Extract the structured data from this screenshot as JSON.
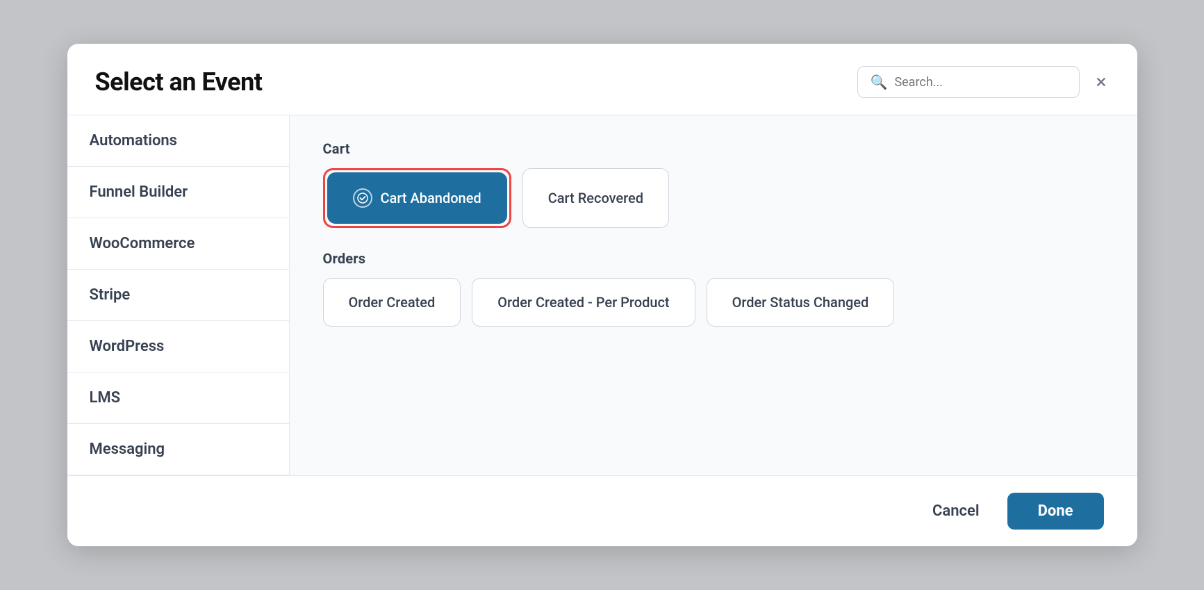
{
  "modal": {
    "title": "Select an Event",
    "search_placeholder": "Search...",
    "close_label": "×"
  },
  "sidebar": {
    "items": [
      {
        "label": "Automations",
        "active": false
      },
      {
        "label": "Funnel Builder",
        "active": false
      },
      {
        "label": "WooCommerce",
        "active": false
      },
      {
        "label": "Stripe",
        "active": false
      },
      {
        "label": "WordPress",
        "active": false
      },
      {
        "label": "LMS",
        "active": false
      },
      {
        "label": "Messaging",
        "active": false
      }
    ]
  },
  "sections": [
    {
      "label": "Cart",
      "events": [
        {
          "label": "Cart Abandoned",
          "selected": true
        },
        {
          "label": "Cart Recovered",
          "selected": false
        }
      ]
    },
    {
      "label": "Orders",
      "events": [
        {
          "label": "Order Created",
          "selected": false
        },
        {
          "label": "Order Created - Per Product",
          "selected": false
        },
        {
          "label": "Order Status Changed",
          "selected": false
        }
      ]
    }
  ],
  "footer": {
    "cancel_label": "Cancel",
    "done_label": "Done"
  },
  "colors": {
    "primary": "#1e6fa0",
    "danger": "#ef4444"
  }
}
